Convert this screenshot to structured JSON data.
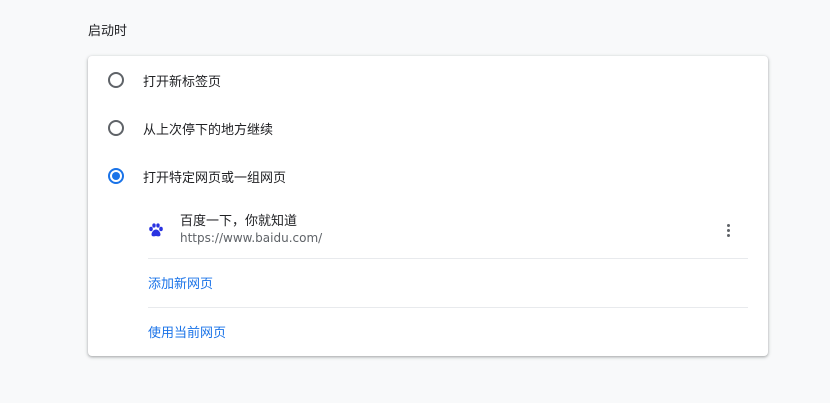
{
  "section": {
    "title": "启动时"
  },
  "startup_options": [
    {
      "label": "打开新标签页",
      "checked": false
    },
    {
      "label": "从上次停下的地方继续",
      "checked": false
    },
    {
      "label": "打开特定网页或一组网页",
      "checked": true
    }
  ],
  "pages": [
    {
      "title": "百度一下，你就知道",
      "url": "https://www.baidu.com/",
      "icon": "baidu-paw-icon"
    }
  ],
  "actions": {
    "add_page": "添加新网页",
    "use_current": "使用当前网页"
  },
  "colors": {
    "accent": "#1a73e8",
    "favicon": "#2932e1"
  }
}
